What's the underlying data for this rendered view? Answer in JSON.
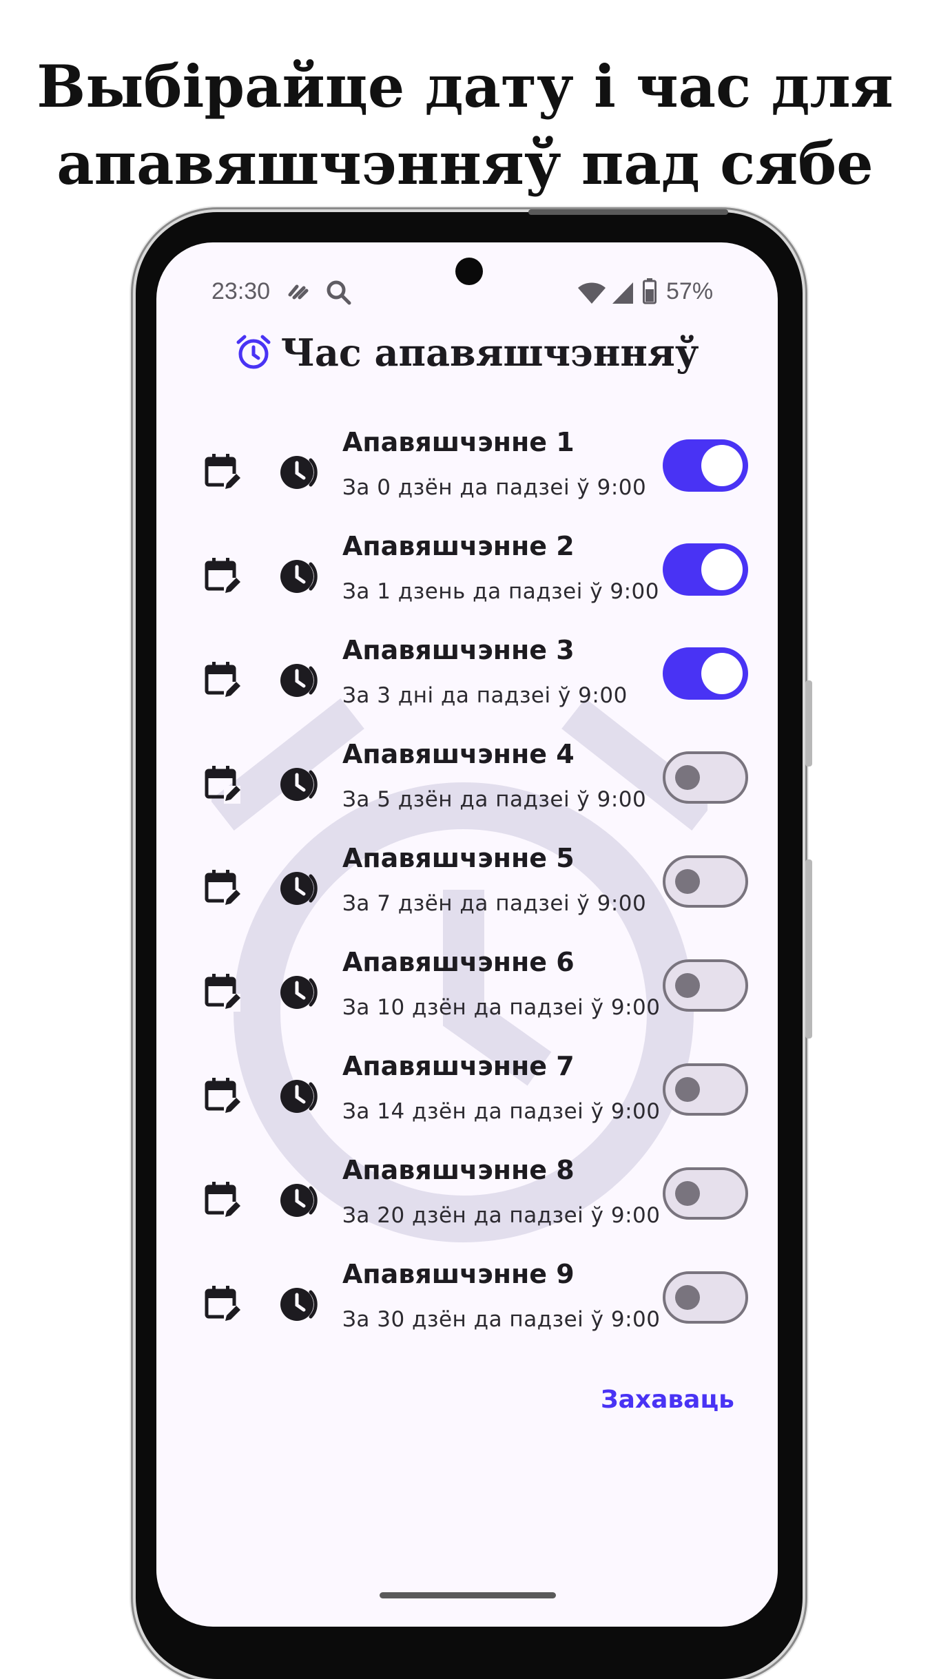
{
  "headline": {
    "line1": "Выбірайце дату і час для",
    "line2": "апавяшчэнняў пад сябе"
  },
  "status_bar": {
    "time": "23:30",
    "battery_percent": "57%",
    "icons": [
      "notification-icon",
      "search-icon",
      "wifi-icon",
      "cell-signal-icon",
      "battery-icon"
    ]
  },
  "app": {
    "title": "Час апавяшчэнняў",
    "title_icon": "alarm-clock-icon",
    "accent_color": "#4933f4",
    "save_label": "Захаваць"
  },
  "notifications": [
    {
      "name": "Апавяшчэнне 1",
      "description": "За 0 дзён да падзеі ў 9:00",
      "enabled": true
    },
    {
      "name": "Апавяшчэнне 2",
      "description": "За 1 дзень да падзеі ў 9:00",
      "enabled": true
    },
    {
      "name": "Апавяшчэнне 3",
      "description": "За 3 дні да падзеі ў 9:00",
      "enabled": true
    },
    {
      "name": "Апавяшчэнне 4",
      "description": "За 5 дзён да падзеі ў 9:00",
      "enabled": false
    },
    {
      "name": "Апавяшчэнне 5",
      "description": "За 7 дзён да падзеі ў 9:00",
      "enabled": false
    },
    {
      "name": "Апавяшчэнне 6",
      "description": "За 10 дзён да падзеі ў 9:00",
      "enabled": false
    },
    {
      "name": "Апавяшчэнне 7",
      "description": "За 14 дзён да падзеі ў 9:00",
      "enabled": false
    },
    {
      "name": "Апавяшчэнне 8",
      "description": "За 20 дзён да падзеі ў 9:00",
      "enabled": false
    },
    {
      "name": "Апавяшчэнне 9",
      "description": "За 30 дзён да падзеі ў 9:00",
      "enabled": false
    }
  ]
}
